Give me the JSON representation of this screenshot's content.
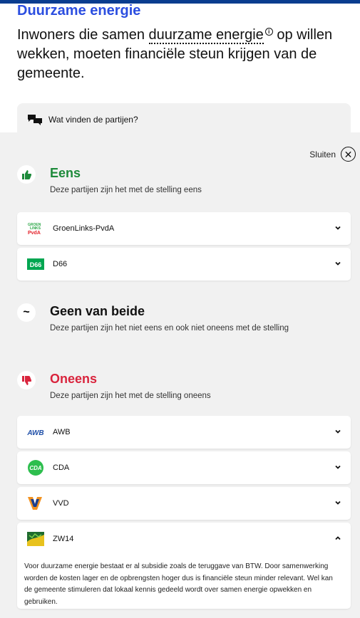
{
  "topic": {
    "title": "Duurzame energie"
  },
  "statement": {
    "before": "Inwoners die samen ",
    "term": "duurzame energie",
    "after": " op willen wekken, moeten financiële steun krijgen van de gemeente."
  },
  "tab": {
    "label": "Wat vinden de partijen?"
  },
  "close": {
    "label": "Sluiten"
  },
  "sections": {
    "agree": {
      "title": "Eens",
      "subtitle": "Deze partijen zijn het met de stelling eens",
      "color": "#1d8a3a",
      "icon": "thumbs-up-icon"
    },
    "neutral": {
      "title": "Geen van beide",
      "subtitle": "Deze partijen zijn het niet eens en ook niet oneens met de stelling",
      "icon": "tilde-icon"
    },
    "disagree": {
      "title": "Oneens",
      "subtitle": "Deze partijen zijn het met de stelling oneens",
      "color": "#d9243d",
      "icon": "thumbs-down-icon"
    }
  },
  "parties": {
    "agree": [
      {
        "name": "GroenLinks-PvdA",
        "logo_text": "GROEN LINKS PvdA"
      },
      {
        "name": "D66",
        "logo_text": "D66"
      }
    ],
    "disagree": [
      {
        "name": "AWB",
        "logo_text": "AWB"
      },
      {
        "name": "CDA",
        "logo_text": "CDA"
      },
      {
        "name": "VVD",
        "logo_text": "VVD"
      },
      {
        "name": "ZW14",
        "logo_text": ""
      }
    ]
  },
  "zw14_explanation": "Voor duurzame energie bestaat er al subsidie zoals de teruggave van BTW. Door samenwerking worden de kosten lager en de opbrengsten hoger dus is financiële steun minder relevant. Wel kan de gemeente stimuleren dat lokaal kennis gedeeld wordt over samen energie opwekken en gebruiken."
}
